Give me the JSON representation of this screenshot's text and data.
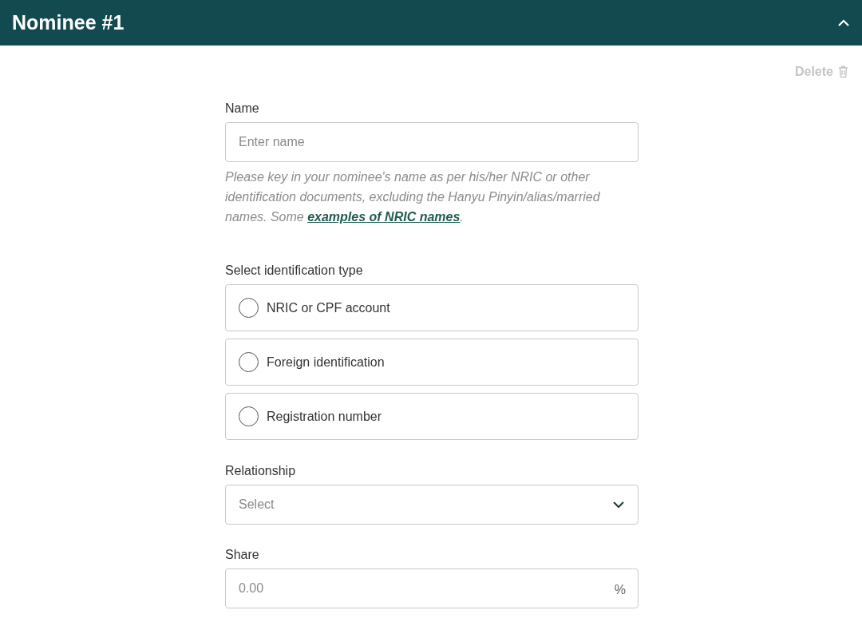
{
  "header": {
    "title": "Nominee #1",
    "expanded": true
  },
  "delete_button": {
    "label": "Delete"
  },
  "name_field": {
    "label": "Name",
    "placeholder": "Enter name",
    "hint": {
      "text_before": "Please key in your nominee's name as per his/her NRIC or other identification documents, excluding the Hanyu Pinyin/alias/married names. Some ",
      "link": "examples of NRIC names",
      "text_after": "."
    }
  },
  "identification_type": {
    "label": "Select identification type",
    "options": [
      {
        "label": "NRIC or CPF account",
        "selected": false
      },
      {
        "label": "Foreign identification",
        "selected": false
      },
      {
        "label": "Registration number",
        "selected": false
      }
    ]
  },
  "relationship": {
    "label": "Relationship",
    "placeholder": "Select"
  },
  "share": {
    "label": "Share",
    "placeholder": "0.00",
    "suffix": "%"
  }
}
